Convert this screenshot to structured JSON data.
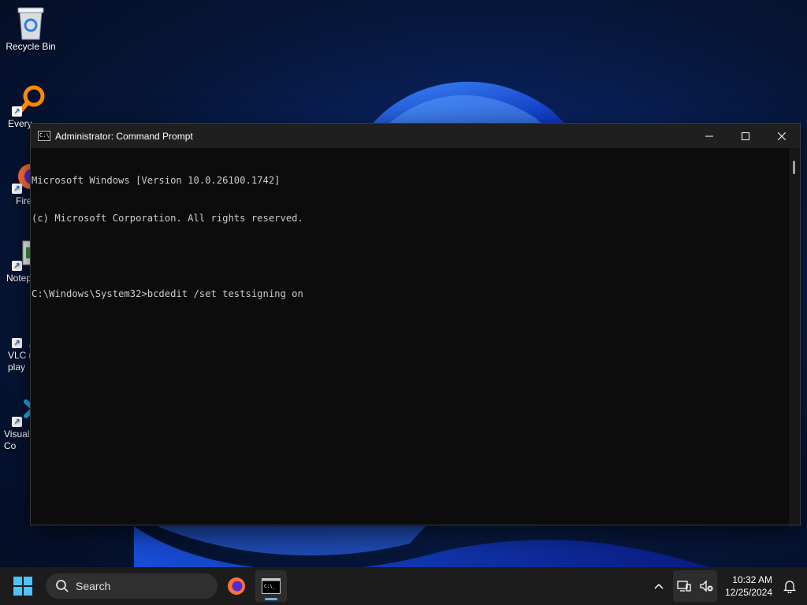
{
  "desktop": {
    "icons": [
      {
        "label": "Recycle Bin",
        "icon": "recycle-bin-icon"
      },
      {
        "label": "Every",
        "icon": "everything-search-icon"
      },
      {
        "label": "Fire",
        "icon": "firefox-icon"
      },
      {
        "label": "Notep",
        "icon": "notepad-icon"
      },
      {
        "label": "VLC r\nplay",
        "icon": "vlc-icon"
      },
      {
        "label": "Visual\nCo",
        "icon": "vscode-icon"
      }
    ]
  },
  "window": {
    "title": "Administrator: Command Prompt",
    "icon": "cmd-icon",
    "console_lines": [
      "Microsoft Windows [Version 10.0.26100.1742]",
      "(c) Microsoft Corporation. All rights reserved.",
      "",
      "C:\\Windows\\System32>bcdedit /set testsigning on"
    ]
  },
  "taskbar": {
    "search_placeholder": "Search",
    "apps": [
      {
        "name": "Firefox",
        "icon": "firefox-icon"
      },
      {
        "name": "Command Prompt",
        "icon": "cmd-icon"
      }
    ],
    "clock_time": "10:32 AM",
    "clock_date": "12/25/2024"
  },
  "colors": {
    "console_bg": "#0c0c0c",
    "console_fg": "#cccccc",
    "titlebar": "#1f1f1f",
    "taskbar": "#1c1c1c",
    "accent": "#60b3ff"
  }
}
